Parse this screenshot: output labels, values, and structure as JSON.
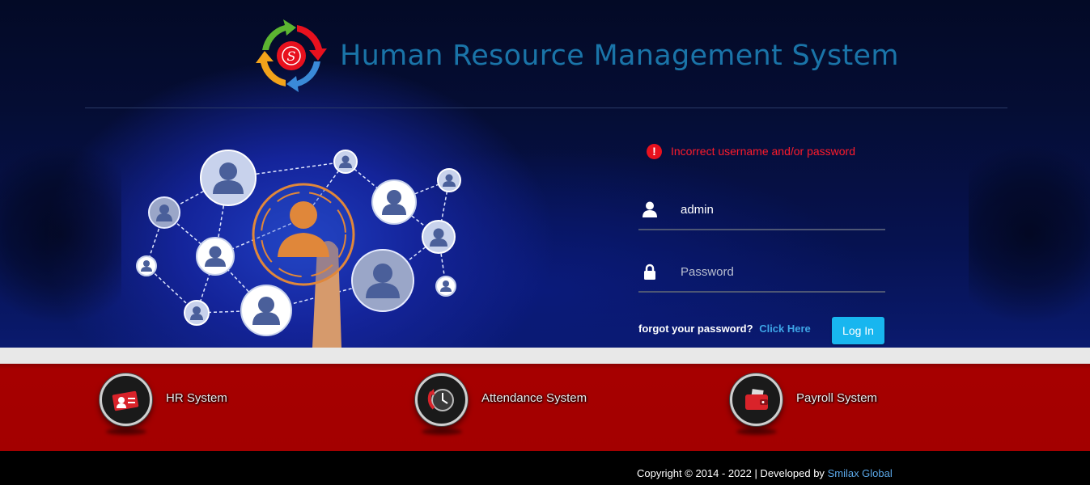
{
  "header": {
    "title": "Human Resource Management System",
    "logo_icon": "hrms-cycle-logo-icon",
    "logo_words": [
      "Human",
      "Resource",
      "Management",
      "System"
    ]
  },
  "login": {
    "error_message": "Incorrect username and/or password",
    "error_icon": "exclamation-circle-icon",
    "username_value": "admin",
    "password_placeholder": "Password",
    "forgot_text": "forgot your password?",
    "forgot_link": "Click Here",
    "login_button": "Log In"
  },
  "modules": [
    {
      "label": "HR System",
      "icon": "id-card-icon"
    },
    {
      "label": "Attendance System",
      "icon": "clock-icon"
    },
    {
      "label": "Payroll System",
      "icon": "wallet-icon"
    }
  ],
  "footer": {
    "copyright": "Copyright © 2014 - 2022 | Developed by",
    "developer": "Smilax Global"
  },
  "colors": {
    "title": "#1a74a8",
    "error": "#ff1b2b",
    "login_button": "#18b6ef",
    "module_band": "#a30000",
    "link": "#3ea6e8"
  }
}
